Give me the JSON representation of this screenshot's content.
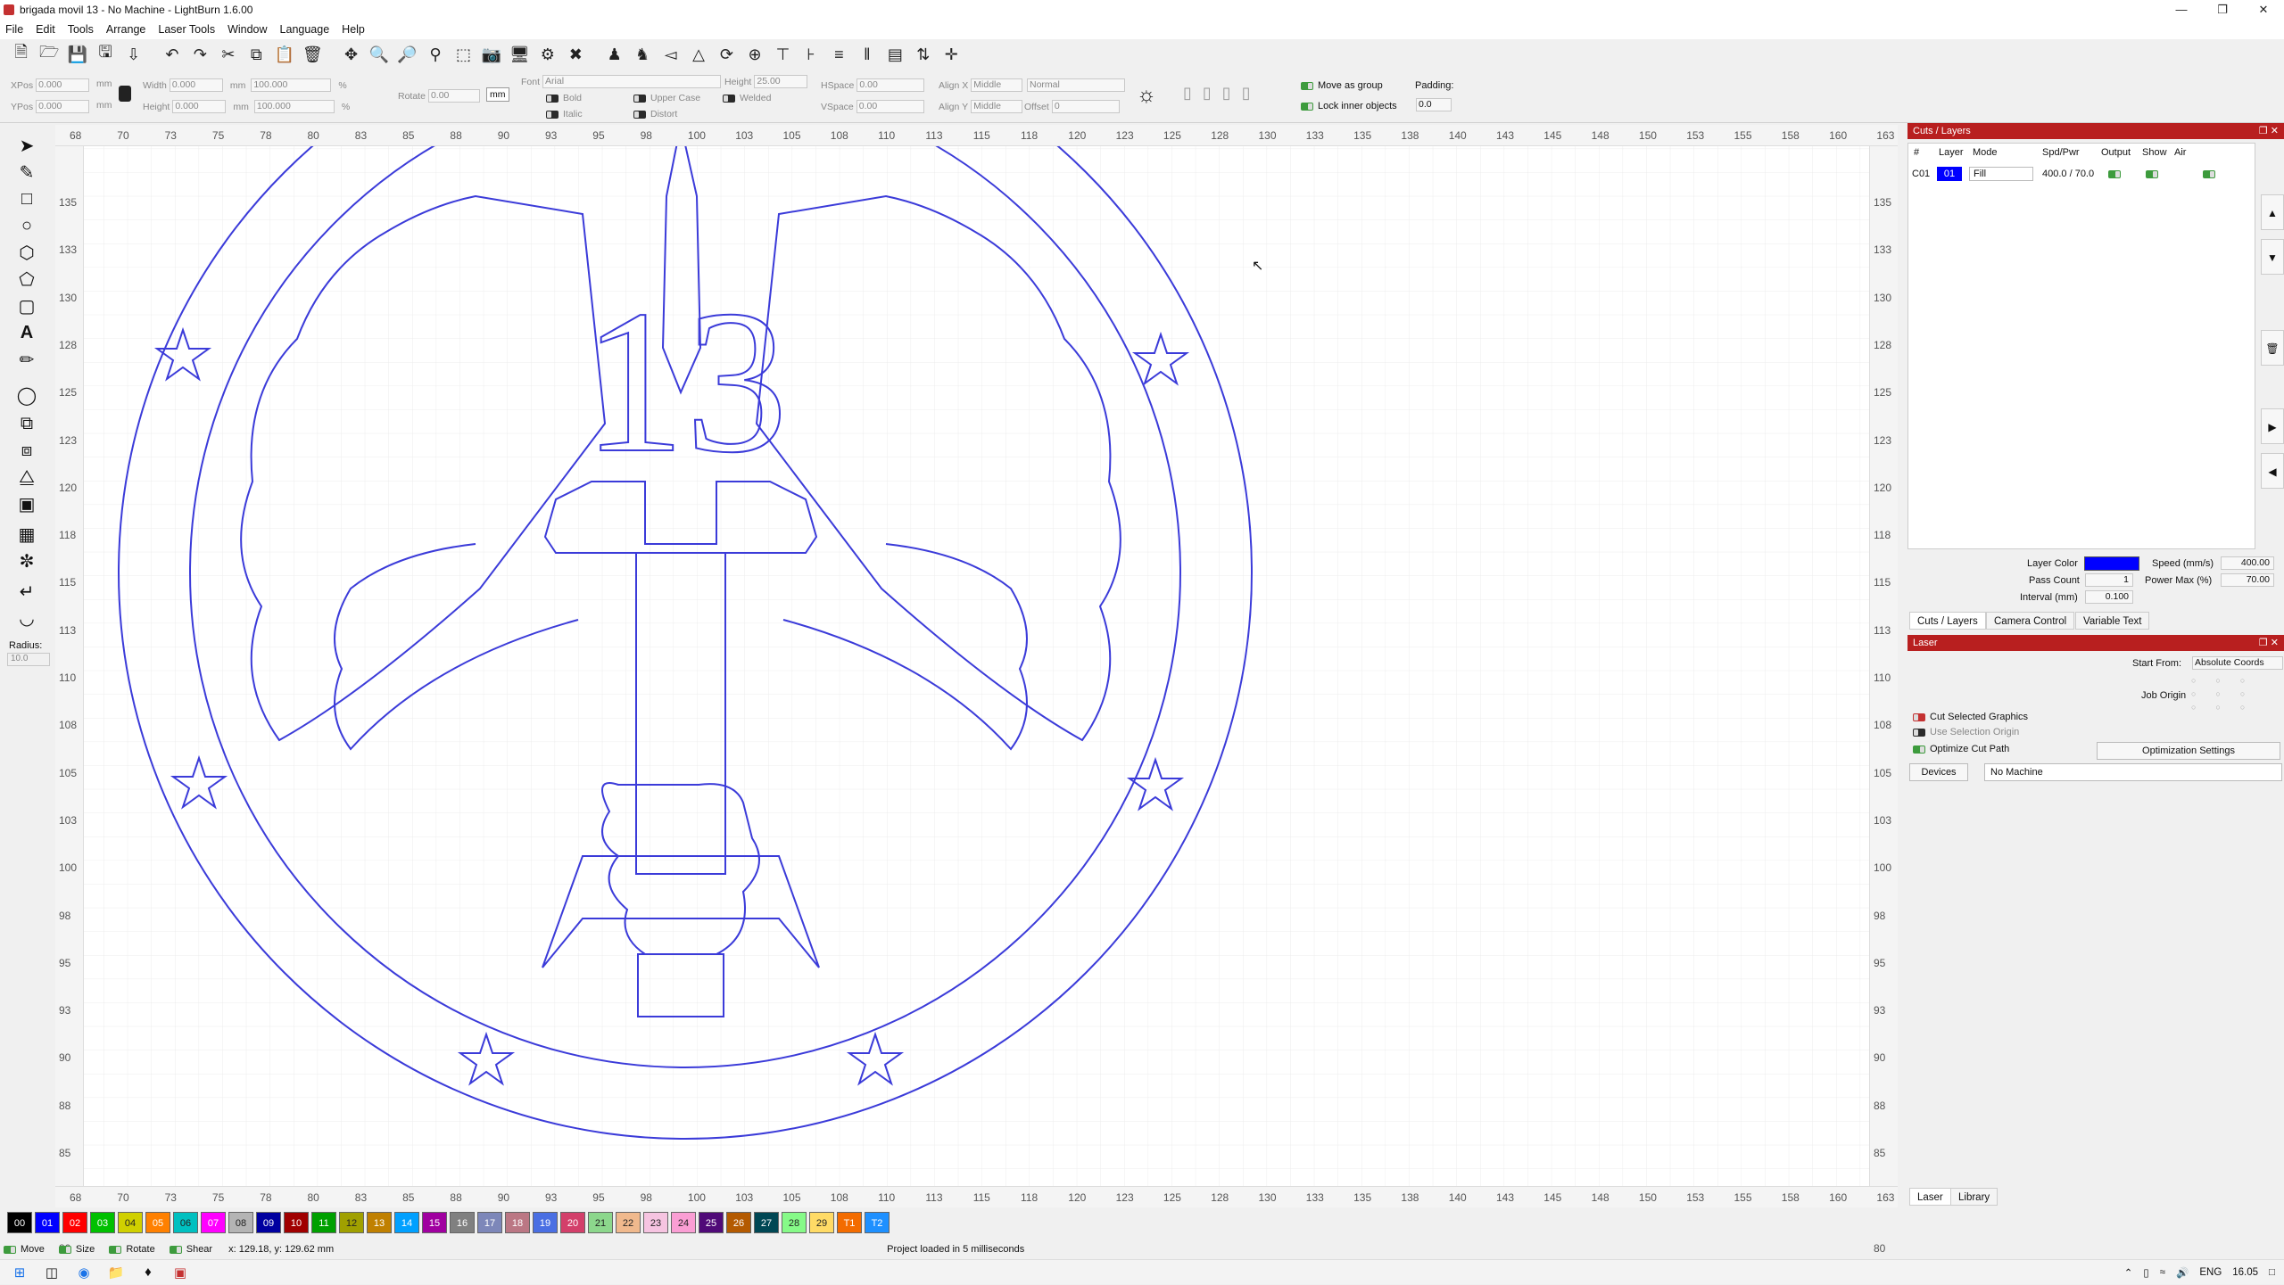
{
  "window": {
    "title": "brigada movil 13 - No Machine - LightBurn 1.6.00"
  },
  "menu": [
    "File",
    "Edit",
    "Tools",
    "Arrange",
    "Laser Tools",
    "Window",
    "Language",
    "Help"
  ],
  "props": {
    "xpos_label": "XPos",
    "xpos": "0.000",
    "ypos_label": "YPos",
    "ypos": "0.000",
    "width_label": "Width",
    "width": "0.000",
    "height_label": "Height",
    "height": "0.000",
    "mm": "mm",
    "pct": "%",
    "scale_w": "100.000",
    "scale_h": "100.000",
    "rotate_label": "Rotate",
    "rotate": "0.00",
    "unit_btn": "mm",
    "font_label": "Font",
    "font": "Arial",
    "textheight_label": "Height",
    "textheight": "25.00",
    "hspace_label": "HSpace",
    "hspace": "0.00",
    "vspace_label": "VSpace",
    "vspace": "0.00",
    "alignx_label": "Align X",
    "alignx": "Middle",
    "aligny_label": "Align Y",
    "aligny": "Middle",
    "normal": "Normal",
    "offset_label": "Offset",
    "offset": "0",
    "bold": "Bold",
    "italic": "Italic",
    "upper": "Upper Case",
    "distort": "Distort",
    "welded": "Welded",
    "move_group": "Move as group",
    "lock_inner": "Lock inner objects",
    "padding_label": "Padding:",
    "padding": "0.0"
  },
  "ruler": {
    "x_ticks": [
      "68",
      "70",
      "73",
      "75",
      "78",
      "80",
      "83",
      "85",
      "88",
      "90",
      "93",
      "95",
      "98",
      "100",
      "103",
      "105",
      "108",
      "110",
      "113",
      "115",
      "118",
      "120",
      "123",
      "125",
      "128",
      "130",
      "133",
      "135",
      "138",
      "140",
      "143",
      "145",
      "148",
      "150",
      "153",
      "155",
      "158",
      "160",
      "163"
    ],
    "y_ticks": [
      "135",
      "133",
      "130",
      "128",
      "125",
      "123",
      "120",
      "118",
      "115",
      "113",
      "110",
      "108",
      "105",
      "103",
      "100",
      "98",
      "95",
      "93",
      "90",
      "88",
      "85",
      "83",
      "80"
    ]
  },
  "design": {
    "numeral": "13"
  },
  "cuts_panel": {
    "title": "Cuts / Layers",
    "headers": [
      "#",
      "Layer",
      "Mode",
      "Spd/Pwr",
      "Output",
      "Show",
      "Air"
    ],
    "row": {
      "id": "C01",
      "layer": "01",
      "mode": "Fill",
      "spdpwr": "400.0 / 70.0"
    },
    "layer_color_label": "Layer Color",
    "speed_label": "Speed (mm/s)",
    "speed": "400.00",
    "pass_label": "Pass Count",
    "pass": "1",
    "power_label": "Power Max (%)",
    "power": "70.00",
    "interval_label": "Interval (mm)",
    "interval": "0.100",
    "layer_color": "#0000ff"
  },
  "tabs1": [
    "Cuts / Layers",
    "Camera Control",
    "Variable Text"
  ],
  "laser_panel": {
    "title": "Laser",
    "start_from_label": "Start From:",
    "start_from": "Absolute Coords",
    "job_origin": "Job Origin",
    "cut_selected": "Cut Selected Graphics",
    "use_sel_origin": "Use Selection Origin",
    "optimize": "Optimize Cut Path",
    "opt_settings": "Optimization Settings",
    "devices": "Devices",
    "machine": "No Machine"
  },
  "tabs2": [
    "Laser",
    "Library"
  ],
  "palette": [
    {
      "l": "00",
      "c": "#000000"
    },
    {
      "l": "01",
      "c": "#0000ff"
    },
    {
      "l": "02",
      "c": "#ff0000"
    },
    {
      "l": "03",
      "c": "#00c000"
    },
    {
      "l": "04",
      "c": "#d0d000"
    },
    {
      "l": "05",
      "c": "#ff8000"
    },
    {
      "l": "06",
      "c": "#00c0c0"
    },
    {
      "l": "07",
      "c": "#ff00ff"
    },
    {
      "l": "08",
      "c": "#b4b4b4"
    },
    {
      "l": "09",
      "c": "#0000a0"
    },
    {
      "l": "10",
      "c": "#a00000"
    },
    {
      "l": "11",
      "c": "#00a000"
    },
    {
      "l": "12",
      "c": "#a0a000"
    },
    {
      "l": "13",
      "c": "#c08000"
    },
    {
      "l": "14",
      "c": "#00a0ff"
    },
    {
      "l": "15",
      "c": "#a000a0"
    },
    {
      "l": "16",
      "c": "#808080"
    },
    {
      "l": "17",
      "c": "#7d87b9"
    },
    {
      "l": "18",
      "c": "#bb7784"
    },
    {
      "l": "19",
      "c": "#4a6fe3"
    },
    {
      "l": "20",
      "c": "#d33f6a"
    },
    {
      "l": "21",
      "c": "#8cd78c"
    },
    {
      "l": "22",
      "c": "#f0b98d"
    },
    {
      "l": "23",
      "c": "#f6c4e1"
    },
    {
      "l": "24",
      "c": "#fa9ed4"
    },
    {
      "l": "25",
      "c": "#500a78"
    },
    {
      "l": "26",
      "c": "#b45a00"
    },
    {
      "l": "27",
      "c": "#004754"
    },
    {
      "l": "28",
      "c": "#86fa88"
    },
    {
      "l": "29",
      "c": "#ffdb66"
    },
    {
      "l": "T1",
      "c": "#f36c00"
    },
    {
      "l": "T2",
      "c": "#1e90ff"
    }
  ],
  "status": {
    "move": "Move",
    "size": "Size",
    "rotate": "Rotate",
    "shear": "Shear",
    "coords": "x: 129.18, y: 129.62 mm",
    "message": "Project loaded in 5 milliseconds"
  },
  "tray": {
    "lang": "ENG",
    "time": "16.05"
  }
}
